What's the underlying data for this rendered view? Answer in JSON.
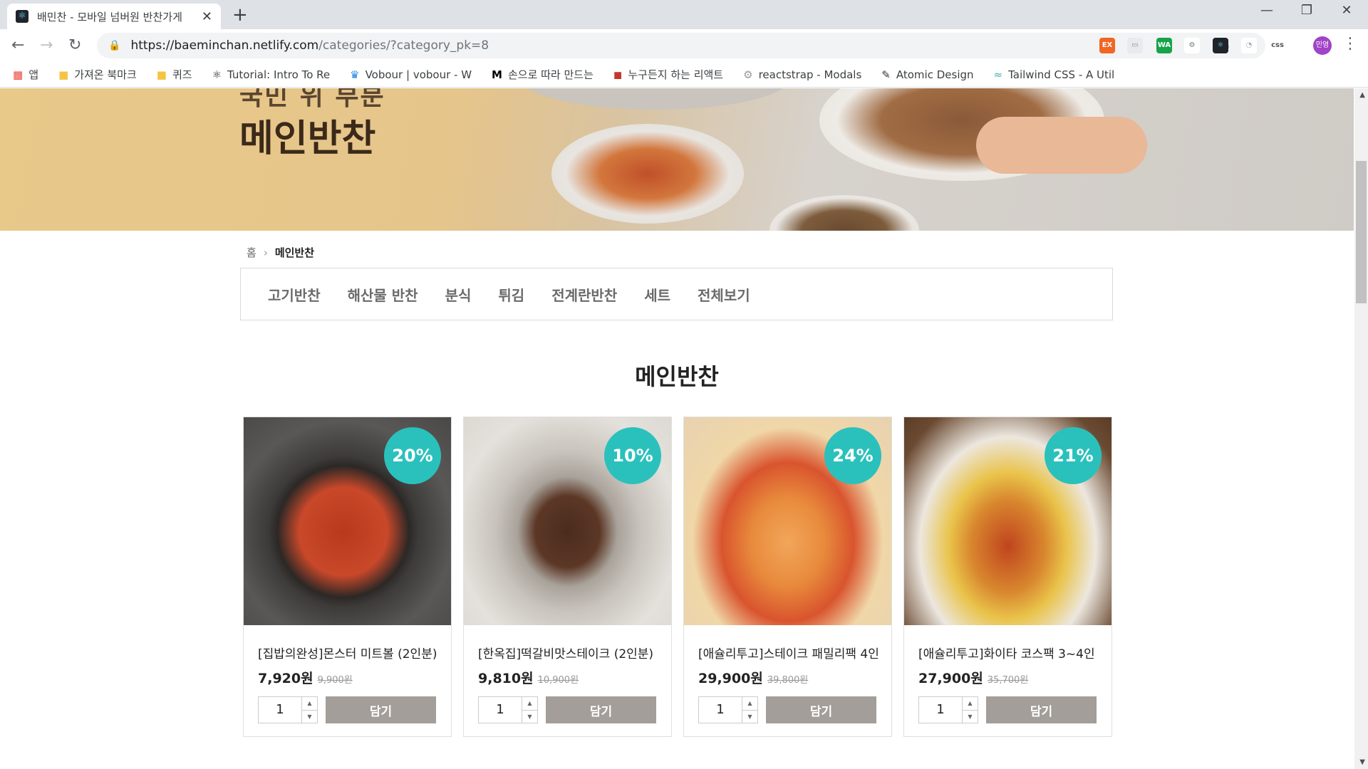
{
  "browser": {
    "tab_title": "배민찬 - 모바일 넘버원 반찬가게",
    "url_host": "https://baeminchan.netlify.com",
    "url_path": "/categories/?category_pk=8",
    "profile_label": "민영"
  },
  "bookmarks": [
    {
      "label": "앱",
      "icon": "apps-grid-icon"
    },
    {
      "label": "가져온 북마크",
      "icon": "folder-icon"
    },
    {
      "label": "퀴즈",
      "icon": "folder-icon"
    },
    {
      "label": "Tutorial: Intro To Re",
      "icon": "react-icon"
    },
    {
      "label": "Vobour | vobour - W",
      "icon": "crown-icon"
    },
    {
      "label": "손으로 따라 만드는",
      "icon": "medium-icon"
    },
    {
      "label": "누구든지 하는 리액트",
      "icon": "vpt-icon"
    },
    {
      "label": "reactstrap - Modals",
      "icon": "gear-icon"
    },
    {
      "label": "Atomic Design",
      "icon": "pen-icon"
    },
    {
      "label": "Tailwind CSS - A Util",
      "icon": "wind-icon"
    }
  ],
  "hero": {
    "subtitle": "국민 위 부분",
    "title": "메인반찬"
  },
  "breadcrumb": {
    "home": "홈",
    "current": "메인반찬"
  },
  "categories": [
    "고기반찬",
    "해산물 반찬",
    "분식",
    "튀김",
    "전계란반찬",
    "세트",
    "전체보기"
  ],
  "section_title": "메인반찬",
  "products": [
    {
      "name": "[집밥의완성]몬스터 미트볼 (2인분)",
      "discount": "20%",
      "price": "7,920원",
      "original": "9,900원",
      "qty": "1",
      "add_label": "담기"
    },
    {
      "name": "[한옥집]떡갈비맛스테이크 (2인분)",
      "discount": "10%",
      "price": "9,810원",
      "original": "10,900원",
      "qty": "1",
      "add_label": "담기"
    },
    {
      "name": "[애슐리투고]스테이크 패밀리팩 4인",
      "discount": "24%",
      "price": "29,900원",
      "original": "39,800원",
      "qty": "1",
      "add_label": "담기"
    },
    {
      "name": "[애슐리투고]화이타 코스팩 3~4인",
      "discount": "21%",
      "price": "27,900원",
      "original": "35,700원",
      "qty": "1",
      "add_label": "담기"
    }
  ],
  "colors": {
    "badge": "#2ac1bc",
    "add_button": "#a39e99"
  }
}
